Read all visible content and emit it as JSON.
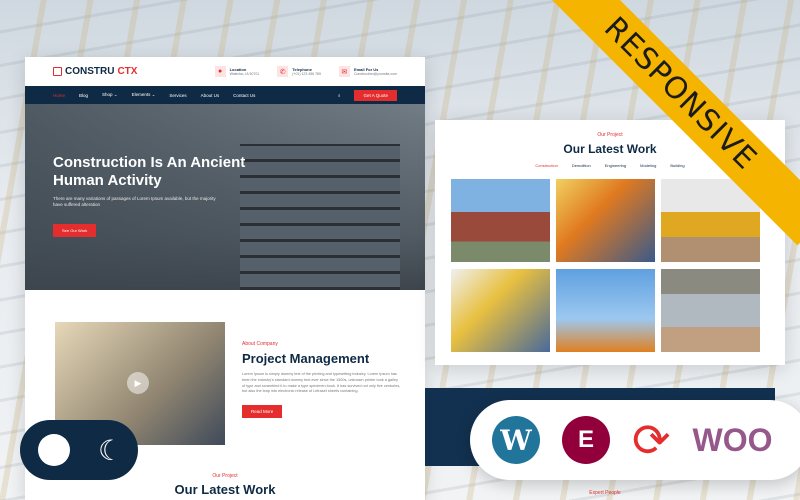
{
  "header": {
    "logo_a": "CONSTRU",
    "logo_b": "CTX",
    "info": [
      {
        "title": "Location",
        "sub": "Waterloo, IA 50701",
        "icon": "map-pin-icon"
      },
      {
        "title": "Telephone",
        "sub": "(+01) 123 456 789",
        "icon": "phone-icon"
      },
      {
        "title": "Email For Us",
        "sub": "Construction@yoursite.com",
        "icon": "envelope-icon"
      }
    ]
  },
  "nav": {
    "items": [
      "Home",
      "Blog",
      "Shop ⌄",
      "Elements ⌄",
      "Services",
      "About Us",
      "Contact Us"
    ],
    "quote": "Get A Quote"
  },
  "hero": {
    "title": "Construction Is An Ancient Human Activity",
    "text": "There are many variations of passages of Lorem Ipsum available, but the majority have suffered alteration",
    "button": "See Our Work"
  },
  "about": {
    "eyebrow": "About Company",
    "title": "Project Management",
    "text": "Lorem Ipsum is simply dummy text of the printing and typesetting industry. Lorem Ipsum has been the industry's standard dummy text ever since the 1500s, unknown printer took a galley of type and scrambled it to make a type specimen book. It has survived not only five centuries, but also the leap into electronic release of Letraset sheets containing.",
    "button": "Read More"
  },
  "bottom": {
    "eyebrow": "Our Project",
    "title": "Our Latest Work",
    "expert": "Expert People"
  },
  "work": {
    "eyebrow": "Our Project",
    "title": "Our Latest Work",
    "tabs": [
      "Construction",
      "Demolition",
      "Engineering",
      "Modeling",
      "Building"
    ]
  },
  "ribbon": "RESPONSIVE",
  "badges": {
    "woo": "WOO"
  },
  "colors": {
    "accent": "#e52d2d",
    "navy": "#0f2a44",
    "ribbon": "#f4b400"
  }
}
